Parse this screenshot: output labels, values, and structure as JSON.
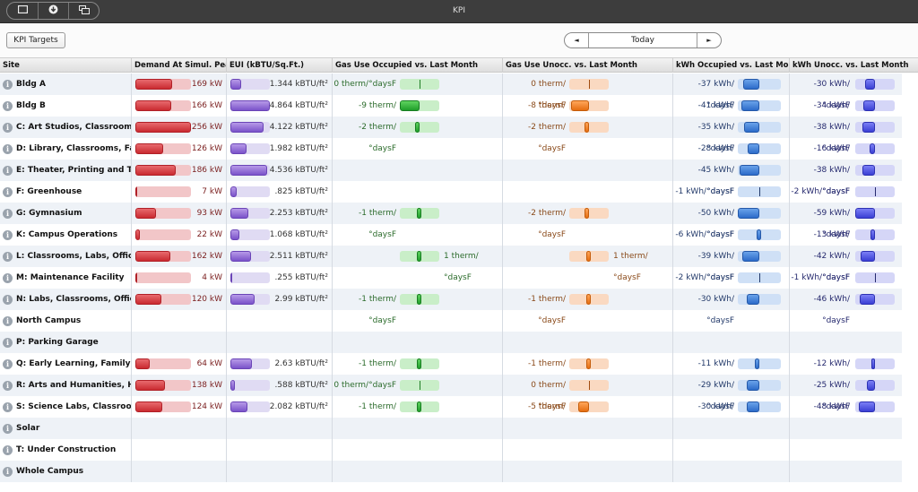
{
  "window": {
    "title": "KPI",
    "toolbar_icons": [
      "window-icon",
      "download-icon",
      "duplicate-window-icon"
    ]
  },
  "toolbar": {
    "kpi_targets_label": "KPI Targets",
    "date_nav": {
      "prev_icon": "◄",
      "label": "Today",
      "next_icon": "►"
    }
  },
  "columns": [
    "Site",
    "Demand At Simul. Peak",
    "EUI (kBTU/Sq.Ft.)",
    "Gas Use Occupied vs. Last Month",
    "Gas Use Unocc. vs. Last Month",
    "kWh Occupied vs. Last Month",
    "kWh Unocc. vs. Last Month"
  ],
  "colors": {
    "demand": "#c92a30",
    "eui": "#7a52c9",
    "gas_occupied": "#1f9e2a",
    "gas_unoccupied": "#e56d10",
    "kwh_occupied": "#2c6bc9",
    "kwh_unoccupied": "#3a3fd4"
  },
  "scales": {
    "demand_max_kw": 256,
    "eui_max": 4.864,
    "gas_max": 9,
    "kwh_occ_max": 50,
    "kwh_unocc_max": 59
  },
  "rows": [
    {
      "site": "Bldg A",
      "demand": 169,
      "demand_label": "169 kW",
      "eui": 1.344,
      "eui_label": "1.344 kBTU/ft²",
      "gas_occ": 0,
      "gas_occ_label": "0 therm/°daysF",
      "gas_unocc": 0,
      "gas_unocc_label": "0 therm/°daysF",
      "kwh_occ": -37,
      "kwh_occ_label": "-37 kWh/°daysF",
      "kwh_unocc": -30,
      "kwh_unocc_label": "-30 kWh/°daysF"
    },
    {
      "site": "Bldg B",
      "demand": 166,
      "demand_label": "166 kW",
      "eui": 4.864,
      "eui_label": "4.864 kBTU/ft²",
      "gas_occ": -9,
      "gas_occ_label": "-9 therm/°daysF",
      "gas_unocc": -8,
      "gas_unocc_label": "-8 therm/°daysF",
      "kwh_occ": -41,
      "kwh_occ_label": "-41 kWh/°daysF",
      "kwh_unocc": -34,
      "kwh_unocc_label": "-34 kWh/°daysF"
    },
    {
      "site": "C: Art Studios, Classrooms, S",
      "demand": 256,
      "demand_label": "256 kW",
      "eui": 4.122,
      "eui_label": "4.122 kBTU/ft²",
      "gas_occ": -2,
      "gas_occ_label": "-2 therm/°daysF",
      "gas_unocc": -2,
      "gas_unocc_label": "-2 therm/°daysF",
      "kwh_occ": -35,
      "kwh_occ_label": "-35 kWh/°daysF",
      "kwh_unocc": -38,
      "kwh_unocc_label": "-38 kWh/°daysF"
    },
    {
      "site": "D: Library, Classrooms, Facul",
      "demand": 126,
      "demand_label": "126 kW",
      "eui": 1.982,
      "eui_label": "1.982 kBTU/ft²",
      "gas_occ": null,
      "gas_occ_label": "",
      "gas_unocc": null,
      "gas_unocc_label": "",
      "kwh_occ": -28,
      "kwh_occ_label": "-28 kWh/°daysF",
      "kwh_unocc": -16,
      "kwh_unocc_label": "-16 kWh/°daysF"
    },
    {
      "site": "E: Theater, Printing and TV S",
      "demand": 186,
      "demand_label": "186 kW",
      "eui": 4.536,
      "eui_label": "4.536 kBTU/ft²",
      "gas_occ": null,
      "gas_occ_label": "",
      "gas_unocc": null,
      "gas_unocc_label": "",
      "kwh_occ": -45,
      "kwh_occ_label": "-45 kWh/°daysF",
      "kwh_unocc": -38,
      "kwh_unocc_label": "-38 kWh/°daysF"
    },
    {
      "site": "F: Greenhouse",
      "demand": 7,
      "demand_label": "7 kW",
      "eui": 0.825,
      "eui_label": ".825 kBTU/ft²",
      "gas_occ": null,
      "gas_occ_label": "",
      "gas_unocc": null,
      "gas_unocc_label": "",
      "kwh_occ": -1,
      "kwh_occ_label": "-1 kWh/°daysF",
      "kwh_unocc": -2,
      "kwh_unocc_label": "-2 kWh/°daysF"
    },
    {
      "site": "G: Gymnasium",
      "demand": 93,
      "demand_label": "93 kW",
      "eui": 2.253,
      "eui_label": "2.253 kBTU/ft²",
      "gas_occ": -1,
      "gas_occ_label": "-1 therm/°daysF",
      "gas_unocc": -2,
      "gas_unocc_label": "-2 therm/°daysF",
      "kwh_occ": -50,
      "kwh_occ_label": "-50 kWh/°daysF",
      "kwh_unocc": -59,
      "kwh_unocc_label": "-59 kWh/°daysF"
    },
    {
      "site": "K: Campus Operations",
      "demand": 22,
      "demand_label": "22 kW",
      "eui": 1.068,
      "eui_label": "1.068 kBTU/ft²",
      "gas_occ": null,
      "gas_occ_label": "",
      "gas_unocc": null,
      "gas_unocc_label": "",
      "kwh_occ": -6,
      "kwh_occ_label": "-6 kWh/°daysF",
      "kwh_unocc": -13,
      "kwh_unocc_label": "-13 kWh/°daysF"
    },
    {
      "site": "L: Classrooms, Labs, Offices",
      "demand": 162,
      "demand_label": "162 kW",
      "eui": 2.511,
      "eui_label": "2.511 kBTU/ft²",
      "gas_occ": 1,
      "gas_occ_label": "1 therm/°daysF",
      "gas_unocc": 1,
      "gas_unocc_label": "1 therm/°daysF",
      "kwh_occ": -39,
      "kwh_occ_label": "-39 kWh/°daysF",
      "kwh_unocc": -42,
      "kwh_unocc_label": "-42 kWh/°daysF"
    },
    {
      "site": "M: Maintenance Facility",
      "demand": 4,
      "demand_label": "4 kW",
      "eui": 0.255,
      "eui_label": ".255 kBTU/ft²",
      "gas_occ": null,
      "gas_occ_label": "",
      "gas_unocc": null,
      "gas_unocc_label": "",
      "kwh_occ": -2,
      "kwh_occ_label": "-2 kWh/°daysF",
      "kwh_unocc": -1,
      "kwh_unocc_label": "-1 kWh/°daysF"
    },
    {
      "site": "N: Labs, Classrooms, Offices,",
      "demand": 120,
      "demand_label": "120 kW",
      "eui": 2.99,
      "eui_label": "2.99 kBTU/ft²",
      "gas_occ": -1,
      "gas_occ_label": "-1 therm/°daysF",
      "gas_unocc": -1,
      "gas_unocc_label": "-1 therm/°daysF",
      "kwh_occ": -30,
      "kwh_occ_label": "-30 kWh/°daysF",
      "kwh_unocc": -46,
      "kwh_unocc_label": "-46 kWh/°daysF"
    },
    {
      "site": "North Campus"
    },
    {
      "site": "P: Parking Garage"
    },
    {
      "site": "Q: Early Learning, Family and",
      "demand": 64,
      "demand_label": "64 kW",
      "eui": 2.63,
      "eui_label": "2.63 kBTU/ft²",
      "gas_occ": -1,
      "gas_occ_label": "-1 therm/°daysF",
      "gas_unocc": -1,
      "gas_unocc_label": "-1 therm/°daysF",
      "kwh_occ": -11,
      "kwh_occ_label": "-11 kWh/°daysF",
      "kwh_unocc": -12,
      "kwh_unocc_label": "-12 kWh/°daysF"
    },
    {
      "site": "R: Arts and Humanities, Heal",
      "demand": 138,
      "demand_label": "138 kW",
      "eui": 0.588,
      "eui_label": ".588 kBTU/ft²",
      "gas_occ": 0,
      "gas_occ_label": "0 therm/°daysF",
      "gas_unocc": 0,
      "gas_unocc_label": "0 therm/°daysF",
      "kwh_occ": -29,
      "kwh_occ_label": "-29 kWh/°daysF",
      "kwh_unocc": -25,
      "kwh_unocc_label": "-25 kWh/°daysF"
    },
    {
      "site": "S: Science Labs, Classrooms,",
      "demand": 124,
      "demand_label": "124 kW",
      "eui": 2.082,
      "eui_label": "2.082 kBTU/ft²",
      "gas_occ": -1,
      "gas_occ_label": "-1 therm/°daysF",
      "gas_unocc": -5,
      "gas_unocc_label": "-5 therm/°daysF",
      "kwh_occ": -30,
      "kwh_occ_label": "-30 kWh/°daysF",
      "kwh_unocc": -48,
      "kwh_unocc_label": "-48 kWh/°daysF"
    },
    {
      "site": "Solar"
    },
    {
      "site": "T: Under Construction"
    },
    {
      "site": "Whole Campus"
    }
  ]
}
